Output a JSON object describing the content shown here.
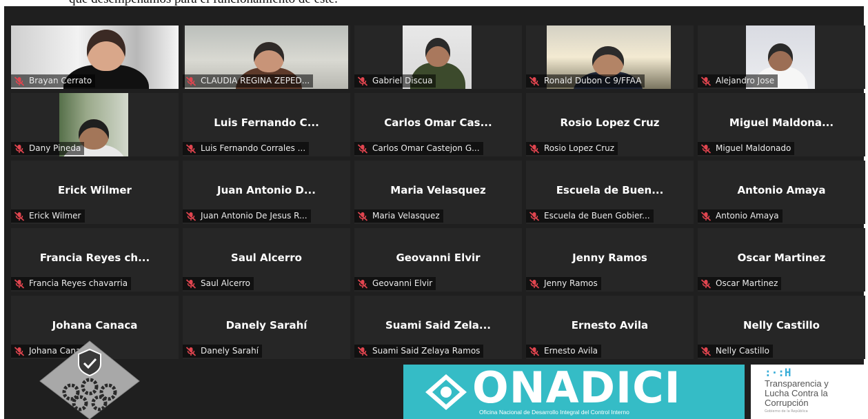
{
  "document": {
    "caption": "que desempeñamos para el funcionamiento de este."
  },
  "participants": [
    {
      "tile_name": "",
      "tag": "Brayan Cerrato",
      "video": true
    },
    {
      "tile_name": "",
      "tag": "CLAUDIA REGINA ZEPED...",
      "video": true
    },
    {
      "tile_name": "",
      "tag": "Gabriel Discua",
      "video": true
    },
    {
      "tile_name": "",
      "tag": "Ronald Dubon C 9/FFAA",
      "video": true
    },
    {
      "tile_name": "",
      "tag": "Alejandro Jose",
      "video": true
    },
    {
      "tile_name": "",
      "tag": "Dany Pineda",
      "video": true
    },
    {
      "tile_name": "Luis Fernando C...",
      "tag": "Luis Fernando Corrales ...",
      "video": false
    },
    {
      "tile_name": "Carlos Omar Cas...",
      "tag": "Carlos Omar Castejon G...",
      "video": false
    },
    {
      "tile_name": "Rosio Lopez Cruz",
      "tag": "Rosio Lopez Cruz",
      "video": false
    },
    {
      "tile_name": "Miguel  Maldona...",
      "tag": "Miguel Maldonado",
      "video": false
    },
    {
      "tile_name": "Erick Wilmer",
      "tag": "Erick Wilmer",
      "video": false
    },
    {
      "tile_name": "Juan Antonio D...",
      "tag": "Juan Antonio De Jesus R...",
      "video": false
    },
    {
      "tile_name": "Maria Velasquez",
      "tag": "Maria Velasquez",
      "video": false
    },
    {
      "tile_name": "Escuela de Buen...",
      "tag": "Escuela de Buen Gobier...",
      "video": false
    },
    {
      "tile_name": "Antonio Amaya",
      "tag": "Antonio Amaya",
      "video": false
    },
    {
      "tile_name": "Francia Reyes ch...",
      "tag": "Francia Reyes chavarria",
      "video": false
    },
    {
      "tile_name": "Saul Alcerro",
      "tag": "Saul Alcerro",
      "video": false
    },
    {
      "tile_name": "Geovanni Elvir",
      "tag": "Geovanni Elvir",
      "video": false
    },
    {
      "tile_name": "Jenny Ramos",
      "tag": "Jenny Ramos",
      "video": false
    },
    {
      "tile_name": "Oscar Martinez",
      "tag": "Oscar Martinez",
      "video": false
    },
    {
      "tile_name": "Johana Canaca",
      "tag": "Johana Canaca",
      "video": false
    },
    {
      "tile_name": "Danely Sarahí",
      "tag": "Danely Sarahí",
      "video": false
    },
    {
      "tile_name": "Suami Said Zela...",
      "tag": "Suami Said Zelaya Ramos",
      "video": false
    },
    {
      "tile_name": "Ernesto Avila",
      "tag": "Ernesto Avila",
      "video": false
    },
    {
      "tile_name": "Nelly Castillo",
      "tag": "Nelly Castillo",
      "video": false
    }
  ],
  "branding": {
    "onadici_word": "ONADICI",
    "onadici_subtitle": "Oficina Nacional de Desarrollo Integral del Control Interno",
    "transparency_mark": ":·:H",
    "transparency_line1": "Transparencia y",
    "transparency_line2": "Lucha Contra la",
    "transparency_line3": "Corrupción",
    "transparency_small": "Gobierno de la República"
  },
  "colors": {
    "meeting_bg": "#1f1f1f",
    "tile_bg": "#262626",
    "muted_icon": "#e0454f",
    "onadici_teal": "#35bcc6"
  }
}
